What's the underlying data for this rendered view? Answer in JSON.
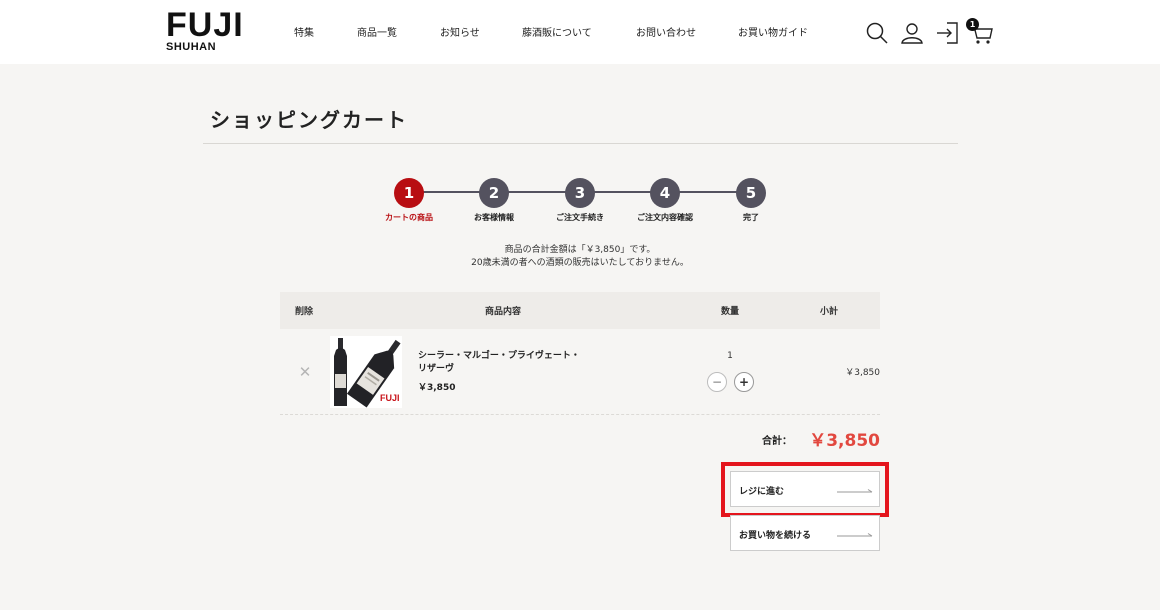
{
  "brand": {
    "logo_big": "FUJI",
    "logo_small": "SHUHAN"
  },
  "nav": {
    "items": [
      {
        "label": "特集"
      },
      {
        "label": "商品一覧"
      },
      {
        "label": "お知らせ"
      },
      {
        "label": "藤酒販について"
      },
      {
        "label": "お問い合わせ"
      },
      {
        "label": "お買い物ガイド"
      }
    ],
    "cart_count": "1",
    "icons": [
      "search-icon",
      "user-icon",
      "login-icon",
      "cart-icon"
    ]
  },
  "page": {
    "title": "ショッピングカート"
  },
  "steps": [
    {
      "number": "1",
      "label": "カートの商品",
      "active": true
    },
    {
      "number": "2",
      "label": "お客様情報",
      "active": false
    },
    {
      "number": "3",
      "label": "ご注文手続き",
      "active": false
    },
    {
      "number": "4",
      "label": "ご注文内容確認",
      "active": false
    },
    {
      "number": "5",
      "label": "完了",
      "active": false
    }
  ],
  "notice": {
    "line1": "商品の合計金額は「￥3,850」です。",
    "line2": "20歳未満の者への酒類の販売はいたしておりません。"
  },
  "table": {
    "headers": {
      "remove": "削除",
      "product": "商品内容",
      "quantity": "数量",
      "subtotal": "小計"
    },
    "rows": [
      {
        "name": "シーラー・マルゴー・プライヴェート・リザーヴ",
        "price": "￥3,850",
        "quantity": "1",
        "subtotal": "￥3,850",
        "thumb_logo": "FUJI"
      }
    ]
  },
  "summary": {
    "total_label": "合計：",
    "total_value": "￥3,850"
  },
  "actions": {
    "checkout_label": "レジに進む",
    "continue_label": "お買い物を続ける"
  },
  "colors": {
    "accent_red": "#b80e12",
    "step_gray": "#54525f",
    "total_red": "#e2483f",
    "highlight_red": "#e4151d"
  }
}
